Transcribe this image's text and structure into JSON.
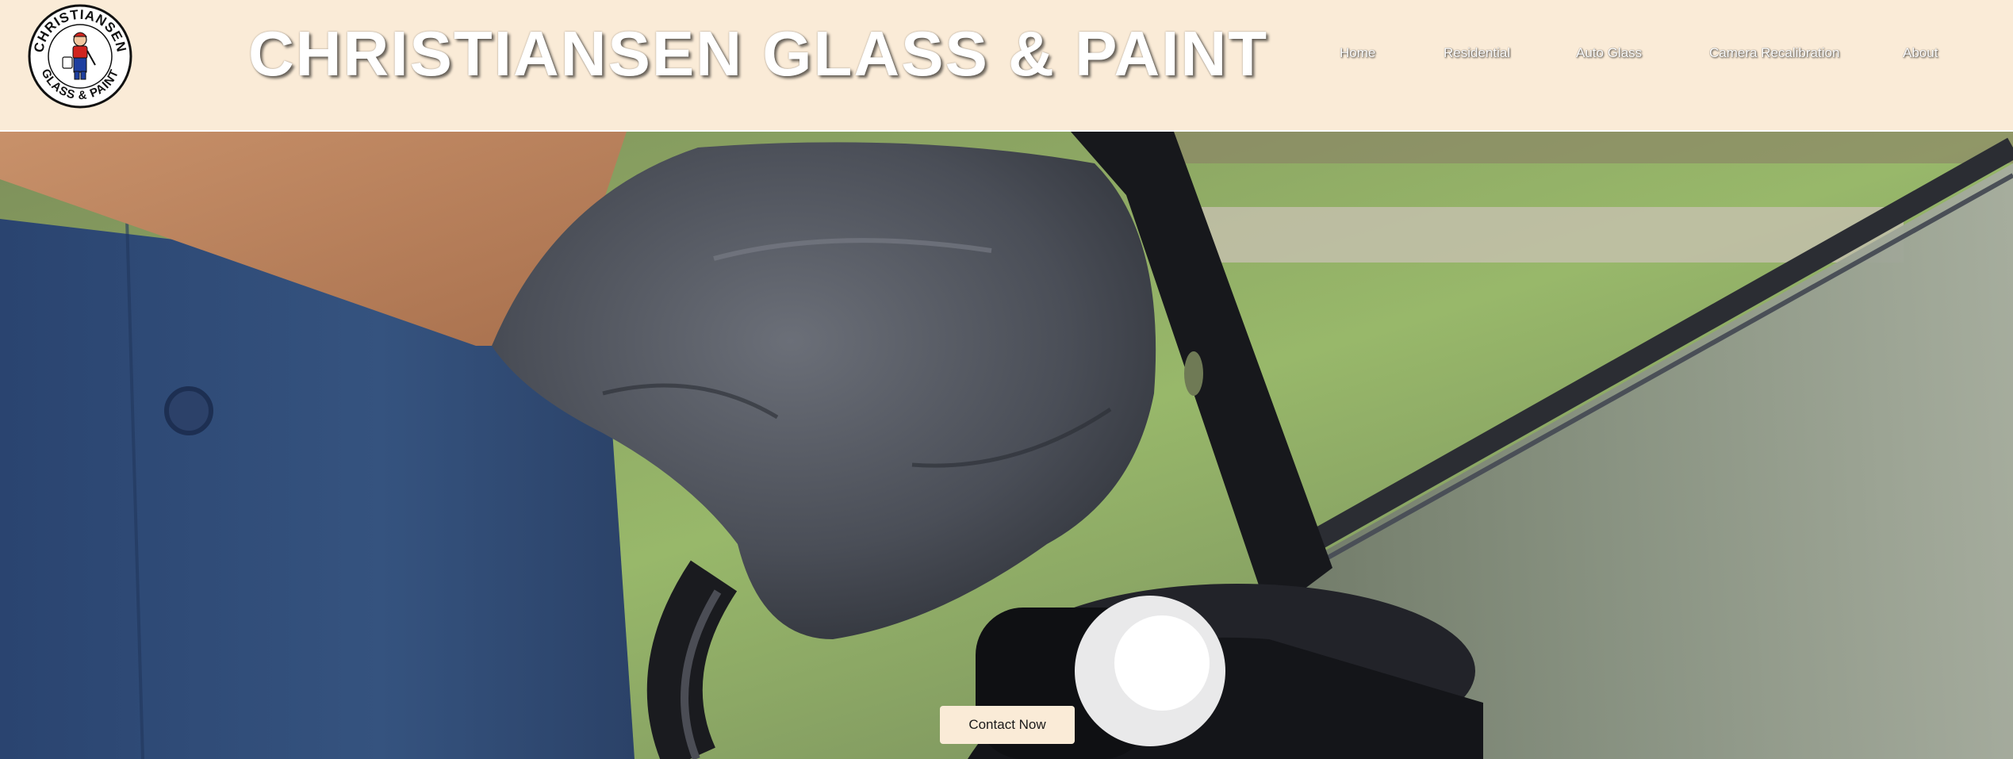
{
  "header": {
    "logo": {
      "text_top": "CHRISTIANSEN",
      "text_bottom": "GLASS & PAINT",
      "icon": "painter-mascot-icon"
    },
    "title": "CHRISTIANSEN GLASS & PAINT",
    "background_color": "#faebd7"
  },
  "nav": {
    "items": [
      {
        "label": "Home"
      },
      {
        "label": "Residential"
      },
      {
        "label": "Auto Glass"
      },
      {
        "label": "Camera Recalibration"
      },
      {
        "label": "About"
      }
    ]
  },
  "hero": {
    "image": "technician-gloved-hand-suction-cup-windshield",
    "cta_label": "Contact Now"
  }
}
